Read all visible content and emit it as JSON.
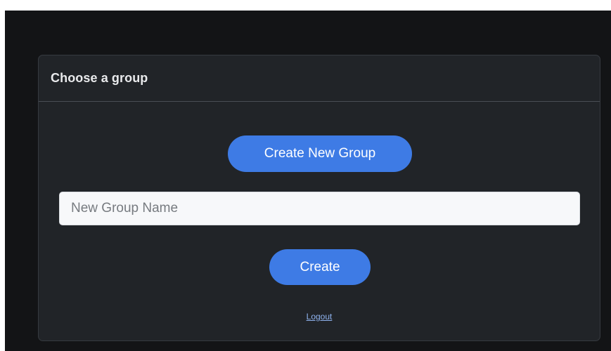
{
  "card": {
    "title": "Choose a group",
    "create_new_group_label": "Create New Group",
    "group_name_input": {
      "placeholder": "New Group Name",
      "value": ""
    },
    "create_label": "Create",
    "logout_label": "Logout"
  },
  "colors": {
    "page_background": "#131416",
    "card_background": "#212428",
    "primary_button": "#3e7be5",
    "link": "#8fb3ef",
    "title_text": "#e9eaec"
  }
}
